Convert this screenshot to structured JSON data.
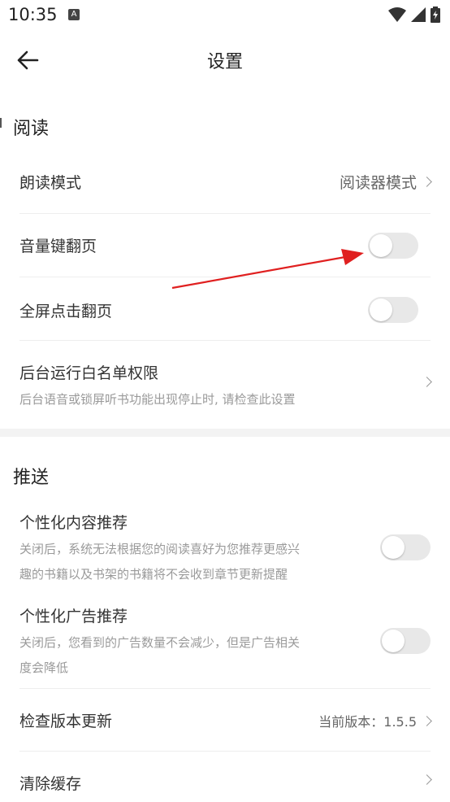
{
  "status_bar": {
    "time": "10:35",
    "a_icon": "A"
  },
  "header": {
    "title": "设置",
    "back_icon": "arrow-left-icon"
  },
  "sections": {
    "reading": {
      "title": "阅读",
      "read_mode": {
        "label": "朗读模式",
        "value": "阅读器模式"
      },
      "volume_key": {
        "label": "音量键翻页",
        "enabled": false
      },
      "fullscreen_tap": {
        "label": "全屏点击翻页",
        "enabled": false
      },
      "background_whitelist": {
        "label": "后台运行白名单权限",
        "description": "后台语音或锁屏听书功能出现停止时, 请检查此设置"
      }
    },
    "push": {
      "title": "推送",
      "personalized_content": {
        "label": "个性化内容推荐",
        "description_line1": "关闭后，系统无法根据您的阅读喜好为您推荐更感兴",
        "description_line2": "趣的书籍以及书架的书籍将不会收到章节更新提醒",
        "enabled": false
      },
      "personalized_ads": {
        "label": "个性化广告推荐",
        "description_line1": "关闭后，您看到的广告数量不会减少，但是广告相关",
        "description_line2": "度会降低",
        "enabled": false
      },
      "check_update": {
        "label": "检查版本更新",
        "value": "当前版本：1.5.5"
      },
      "clear_cache": {
        "label": "清除缓存"
      }
    }
  },
  "colors": {
    "annotation_arrow": "#e02020",
    "toggle_off": "#e8e8e8",
    "divider": "#eeeeee"
  }
}
